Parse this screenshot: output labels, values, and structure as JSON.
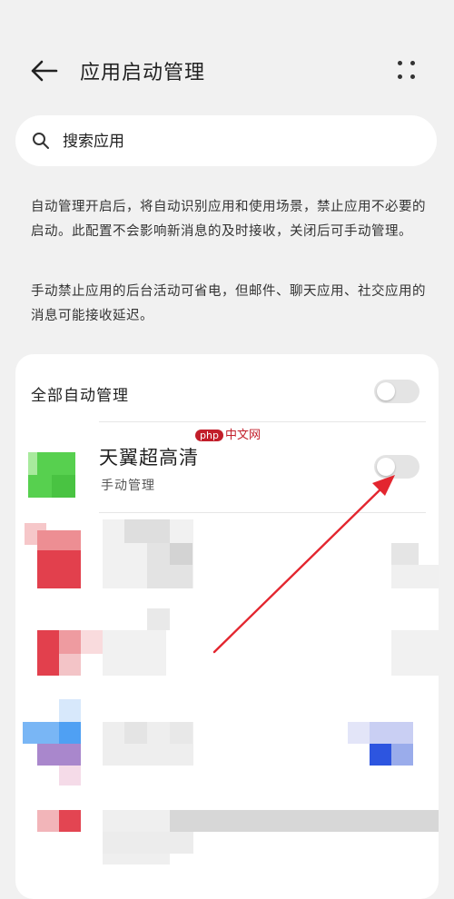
{
  "header": {
    "title": "应用启动管理",
    "back_icon": "arrow-left-icon",
    "more_icon": "more-dots-icon"
  },
  "search": {
    "placeholder": "搜索应用",
    "value": ""
  },
  "description": {
    "para1": "自动管理开启后，将自动识别应用和使用场景，禁止应用不必要的启动。此配置不会影响新消息的及时接收，关闭后可手动管理。",
    "para2": "手动禁止应用的后台活动可省电，但邮件、聊天应用、社交应用的消息可能接收延迟。"
  },
  "list": {
    "all_auto_label": "全部自动管理",
    "all_auto_on": false,
    "apps": [
      {
        "name": "天翼超高清",
        "status": "手动管理",
        "toggle_on": false
      }
    ]
  },
  "watermark": {
    "badge": "php",
    "text": "中文网"
  },
  "colors": {
    "background": "#f1f1f1",
    "card": "#ffffff",
    "toggle_off": "#e4e4e4",
    "annotation_arrow": "#e3262f"
  }
}
